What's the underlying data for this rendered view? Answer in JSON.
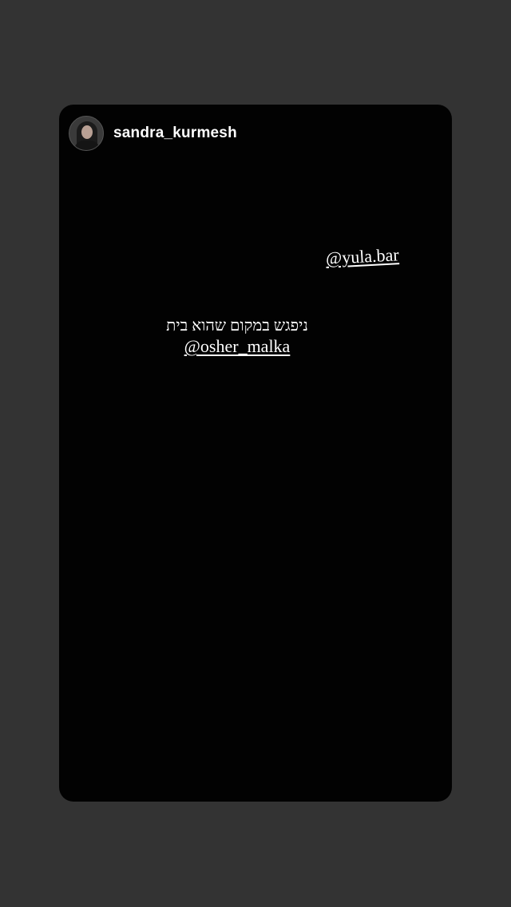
{
  "story": {
    "username": "sandra_kurmesh",
    "mention_top": "@yula.bar",
    "caption_text": "ניפגש במקום שהוא בית",
    "mention_bottom": "@osher_malka"
  }
}
